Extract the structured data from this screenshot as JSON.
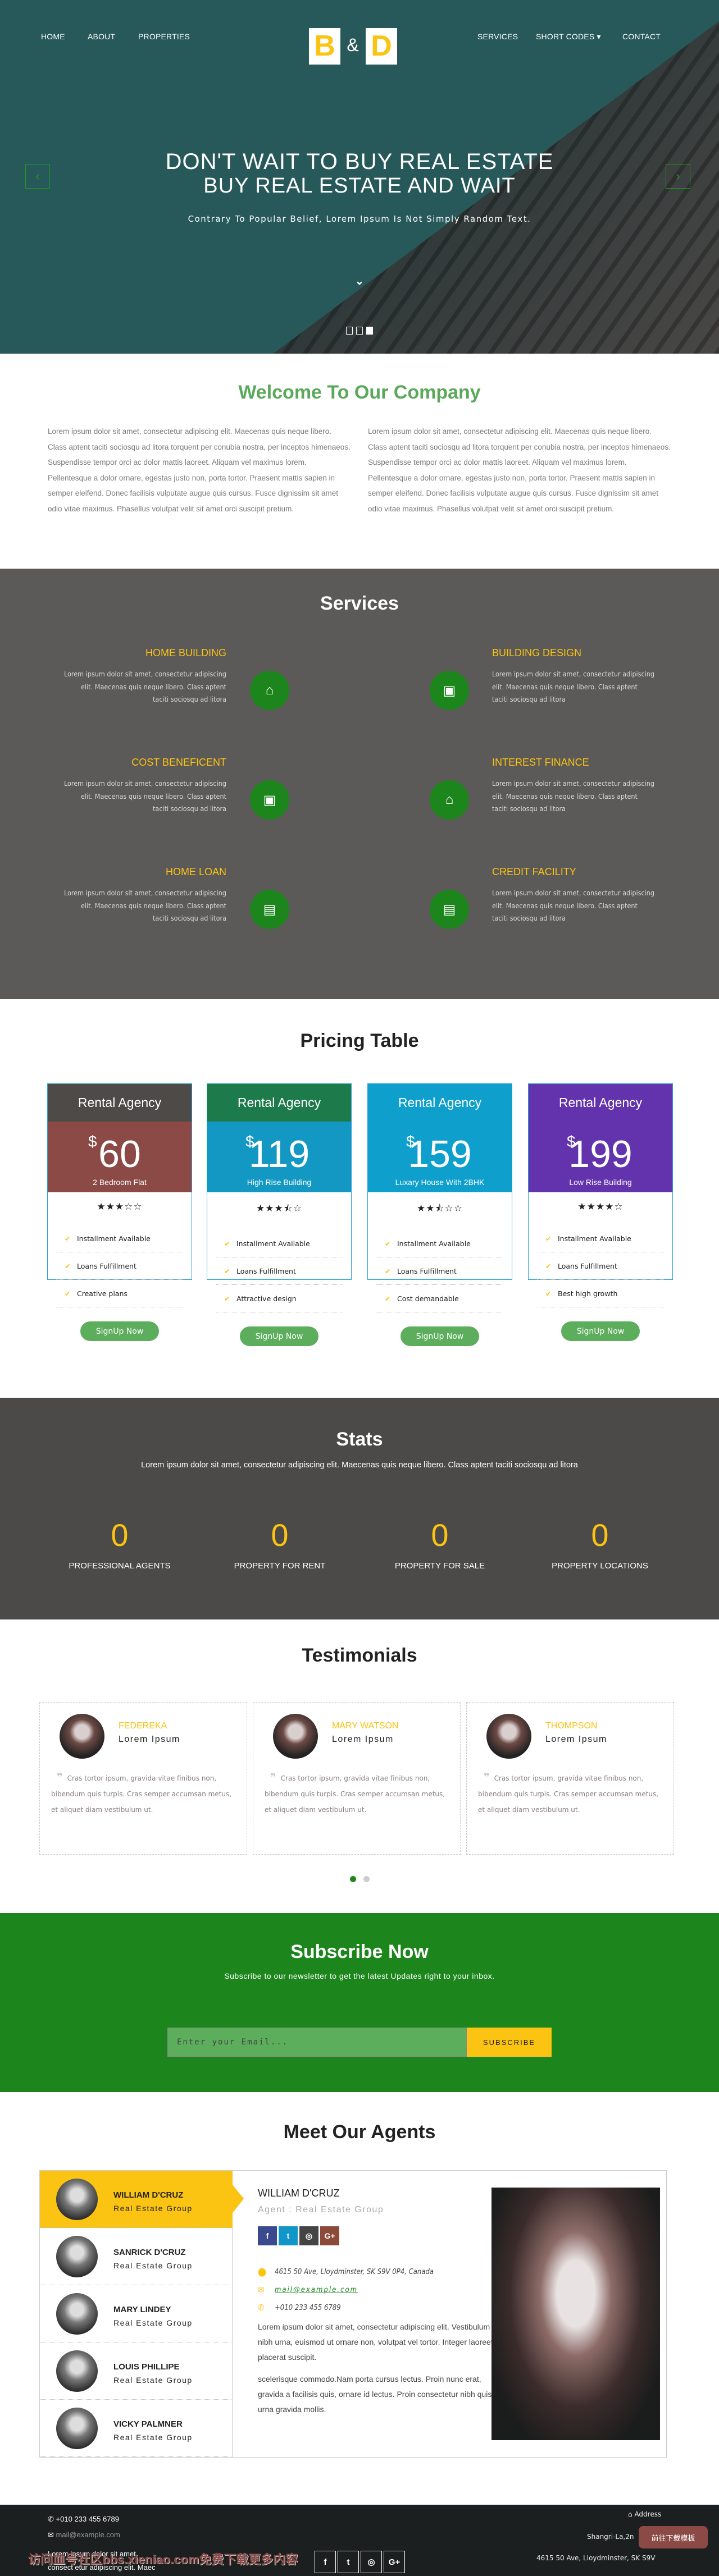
{
  "nav": {
    "left": [
      "HOME",
      "ABOUT",
      "PROPERTIES"
    ],
    "right": [
      "SERVICES",
      "SHORT CODES ▾",
      "CONTACT"
    ]
  },
  "logo": {
    "left": "B",
    "amp": "&",
    "right": "D"
  },
  "hero": {
    "line1": "DON'T WAIT TO BUY REAL ESTATE",
    "line2": "BUY REAL ESTATE AND WAIT",
    "subtitle": "Contrary To Popular Belief, Lorem Ipsum Is Not Simply Random Text.",
    "prev": "‹",
    "next": "›",
    "scroll": "⌄",
    "active_slide": 3,
    "slide_count": 3
  },
  "welcome": {
    "title": "Welcome To Our Company",
    "col1": "Lorem ipsum dolor sit amet, consectetur adipiscing elit. Maecenas quis neque libero. Class aptent taciti sociosqu ad litora torquent per conubia nostra, per inceptos himenaeos. Suspendisse tempor orci ac dolor mattis laoreet. Aliquam vel maximus lorem. Pellentesque a dolor ornare, egestas justo non, porta tortor. Praesent mattis sapien in semper eleifend. Donec facilisis vulputate augue quis cursus. Fusce dignissim sit amet odio vitae maximus. Phasellus volutpat velit sit amet orci suscipit pretium.",
    "col2": "Lorem ipsum dolor sit amet, consectetur adipiscing elit. Maecenas quis neque libero. Class aptent taciti sociosqu ad litora torquent per conubia nostra, per inceptos himenaeos. Suspendisse tempor orci ac dolor mattis laoreet. Aliquam vel maximus lorem. Pellentesque a dolor ornare, egestas justo non, porta tortor. Praesent mattis sapien in semper eleifend. Donec facilisis vulputate augue quis cursus. Fusce dignissim sit amet odio vitae maximus. Phasellus volutpat velit sit amet orci suscipit pretium."
  },
  "services": {
    "title": "Services",
    "items": [
      {
        "title": "HOME BUILDING",
        "text": "Lorem ipsum dolor sit amet, consectetur adipiscing elit. Maecenas quis neque libero. Class aptent taciti sociosqu ad litora",
        "icon": "home-icon"
      },
      {
        "title": "BUILDING DESIGN",
        "text": "Lorem ipsum dolor sit amet, consectetur adipiscing elit. Maecenas quis neque libero. Class aptent taciti sociosqu ad litora",
        "icon": "money-icon"
      },
      {
        "title": "COST BENEFICENT",
        "text": "Lorem ipsum dolor sit amet, consectetur adipiscing elit. Maecenas quis neque libero. Class aptent taciti sociosqu ad litora",
        "icon": "money-icon"
      },
      {
        "title": "INTEREST FINANCE",
        "text": "Lorem ipsum dolor sit amet, consectetur adipiscing elit. Maecenas quis neque libero. Class aptent taciti sociosqu ad litora",
        "icon": "home-icon"
      },
      {
        "title": "HOME LOAN",
        "text": "Lorem ipsum dolor sit amet, consectetur adipiscing elit. Maecenas quis neque libero. Class aptent taciti sociosqu ad litora",
        "icon": "briefcase-icon"
      },
      {
        "title": "CREDIT FACILITY",
        "text": "Lorem ipsum dolor sit amet, consectetur adipiscing elit. Maecenas quis neque libero. Class aptent taciti sociosqu ad litora",
        "icon": "briefcase-icon"
      }
    ]
  },
  "pricing": {
    "title": "Pricing Table",
    "cards": [
      {
        "title": "Rental Agency",
        "currency": "$",
        "price": "60",
        "subtitle": "2 Bedroom Flat",
        "rating": 3,
        "features": [
          "Installment Available",
          "Loans Fulfillment",
          "Creative plans"
        ],
        "button": "SignUp Now",
        "header_color": "#4d4a47",
        "price_color": "#8b4a45"
      },
      {
        "title": "Rental Agency",
        "currency": "$",
        "price": "119",
        "subtitle": "High Rise Building",
        "rating": 3.5,
        "features": [
          "Installment Available",
          "Loans Fulfillment",
          "Attractive design"
        ],
        "button": "SignUp Now",
        "header_color": "#1d7a4a",
        "price_color": "#1298c2"
      },
      {
        "title": "Rental Agency",
        "currency": "$",
        "price": "159",
        "subtitle": "Luxary House With 2BHK",
        "rating": 2.5,
        "features": [
          "Installment Available",
          "Loans Fulfillment",
          "Cost demandable"
        ],
        "button": "SignUp Now",
        "header_color": "#0f9fcc",
        "price_color": "#0f9fcc"
      },
      {
        "title": "Rental Agency",
        "currency": "$",
        "price": "199",
        "subtitle": "Low Rise Building",
        "rating": 4,
        "features": [
          "Installment Available",
          "Loans Fulfillment",
          "Best high growth"
        ],
        "button": "SignUp Now",
        "header_color": "#6233ad",
        "price_color": "#6233ad"
      }
    ]
  },
  "stats": {
    "title": "Stats",
    "subtitle": "Lorem ipsum dolor sit amet, consectetur adipiscing elit. Maecenas quis neque libero. Class aptent taciti sociosqu ad litora",
    "items": [
      {
        "value": "0",
        "label": "PROFESSIONAL AGENTS"
      },
      {
        "value": "0",
        "label": "PROPERTY FOR RENT"
      },
      {
        "value": "0",
        "label": "PROPERTY FOR SALE"
      },
      {
        "value": "0",
        "label": "PROPERTY LOCATIONS"
      }
    ]
  },
  "testimonials": {
    "title": "Testimonials",
    "items": [
      {
        "name": "FEDEREKA",
        "role": "Lorem Ipsum",
        "quote": "Cras tortor ipsum, gravida vitae finibus non, bibendum quis turpis. Cras semper accumsan metus, et aliquet diam vestibulum ut."
      },
      {
        "name": "MARY WATSON",
        "role": "Lorem Ipsum",
        "quote": "Cras tortor ipsum, gravida vitae finibus non, bibendum quis turpis. Cras semper accumsan metus, et aliquet diam vestibulum ut."
      },
      {
        "name": "THOMPSON",
        "role": "Lorem Ipsum",
        "quote": "Cras tortor ipsum, gravida vitae finibus non, bibendum quis turpis. Cras semper accumsan metus, et aliquet diam vestibulum ut."
      }
    ],
    "active_page": 1,
    "page_count": 2
  },
  "subscribe": {
    "title": "Subscribe Now",
    "subtitle": "Subscribe to our newsletter to get the latest Updates right to your inbox.",
    "placeholder": "Enter your Email...",
    "button": "SUBSCRIBE"
  },
  "agents": {
    "title": "Meet Our Agents",
    "list": [
      {
        "name": "WILLIAM D'CRUZ",
        "org": "Real Estate Group",
        "active": true
      },
      {
        "name": "SANRICK D'CRUZ",
        "org": "Real Estate Group"
      },
      {
        "name": "MARY LINDEY",
        "org": "Real Estate Group"
      },
      {
        "name": "LOUIS PHILLIPE",
        "org": "Real Estate Group"
      },
      {
        "name": "VICKY PALMNER",
        "org": "Real Estate Group"
      }
    ],
    "detail": {
      "name": "WILLIAM D'CRUZ",
      "role": "Agent : Real Estate Group",
      "social": [
        "f",
        "t",
        "◎",
        "G+"
      ],
      "address": "4615 50 Ave, Lloydminster, SK S9V 0P4, Canada",
      "email": "mail@example.com",
      "phone": "+010 233 455 6789",
      "para1": "Lorem ipsum dolor sit amet, consectetur adipiscing elit. Vestibulum nibh urna, euismod ut ornare non, volutpat vel tortor. Integer laoreet placerat suscipit.",
      "para2": "scelerisque commodo.Nam porta cursus lectus. Proin nunc erat, gravida a facilisis quis, ornare id lectus. Proin consectetur nibh quis urna gravida mollis."
    },
    "social_colors": [
      "#3b4a8e",
      "#1296c8",
      "#444444",
      "#8b4a3a"
    ]
  },
  "footer": {
    "phone": "+010 233 455 6789",
    "email": "mail@example.com",
    "text1": "Lorem ipsum dolor sit amet",
    "text2": "consect etur adipiscing elit. Maec",
    "social": [
      "f",
      "t",
      "◎",
      "G+"
    ],
    "address_label": "Address",
    "address1": "Shangri-La,2n",
    "address2": "4615 50 Ave, Lloydminster, SK S9V",
    "watermark": "访问血号社区bbs.xieniao.com免费下载更多内容",
    "download_button": "前往下载模板"
  },
  "colors": {
    "accent_yellow": "#fbc312",
    "green": "#1c861c",
    "hero": "#28595a",
    "services_bg": "#5b5a58",
    "stats_bg": "#4b4a48",
    "footer_bg": "#1c1f20"
  }
}
